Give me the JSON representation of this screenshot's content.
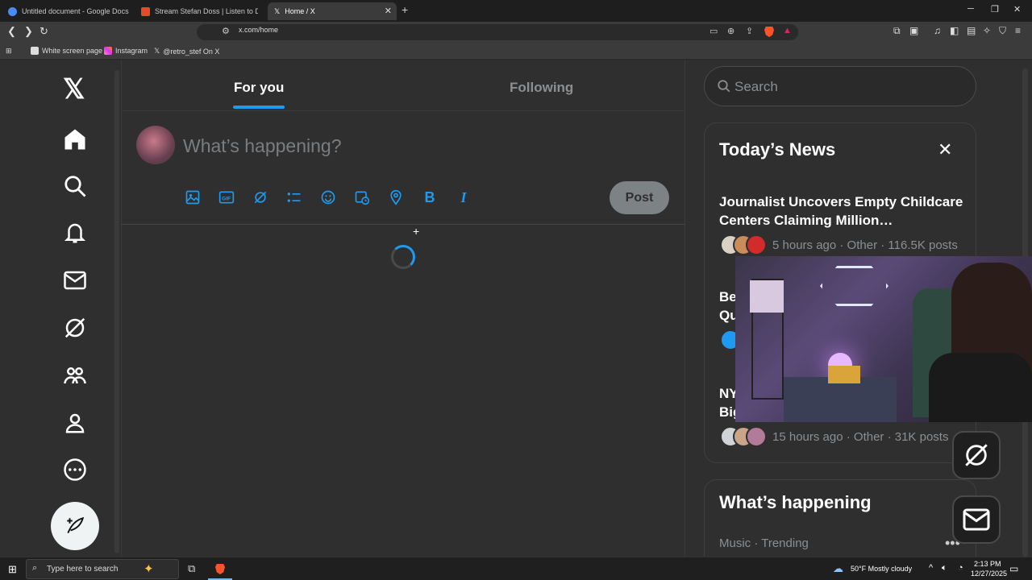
{
  "browser": {
    "tabs": [
      {
        "title": "Untitled document - Google Docs",
        "active": false
      },
      {
        "title": "Stream Stefan Doss | Listen to Decen",
        "active": false
      },
      {
        "title": "Home / X",
        "active": true
      }
    ],
    "new_tab": "+",
    "url": "x.com/home",
    "bookmarks": [
      "White screen page",
      "Instagram",
      "@retro_stef On X"
    ]
  },
  "x": {
    "logo": "𝕏",
    "feed_tabs": [
      "For you",
      "Following"
    ],
    "composer_placeholder": "What’s happening?",
    "post_label": "Post",
    "search_placeholder": "Search",
    "news": {
      "title": "Today’s News",
      "items": [
        {
          "headline": "Journalist Uncovers Empty Childcare Centers Claiming Million…",
          "meta": "5 hours ago · Other · 116.5K posts"
        },
        {
          "headline": "Be… Qu…",
          "meta": ""
        },
        {
          "headline": "NY… Big…",
          "meta": "15 hours ago · Other · 31K posts"
        }
      ]
    },
    "happening": {
      "title": "What’s happening",
      "subtitle": "Music · Trending"
    },
    "accent": "#1d9bf0"
  },
  "taskbar": {
    "search_placeholder": "Type here to search",
    "weather": "50°F  Mostly cloudy",
    "time": "2:13 PM",
    "date": "12/27/2025"
  }
}
